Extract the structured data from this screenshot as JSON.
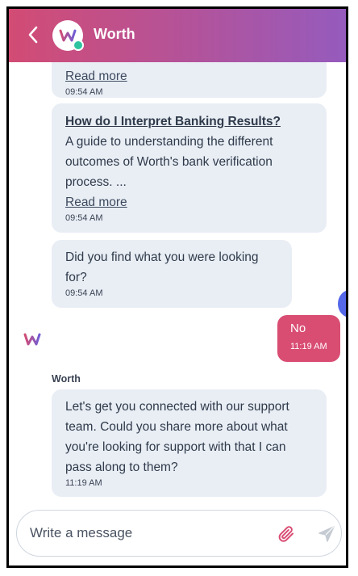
{
  "header": {
    "title": "Worth",
    "colors": {
      "gradient_start": "#d24c74",
      "gradient_end": "#955bbd"
    }
  },
  "messages": [
    {
      "id": "article-1-tail",
      "link_label": "Read more",
      "time": "09:54 AM"
    },
    {
      "id": "article-2",
      "title": "How do I Interpret Banking Results?",
      "body_lines": [
        "A guide to understanding the different",
        "outcomes of Worth's bank verification",
        "process. ..."
      ],
      "link_label": "Read more",
      "time": "09:54 AM"
    },
    {
      "id": "prompt",
      "body_lines": [
        "Did you find what you were looking",
        "for?"
      ],
      "time": "09:54 AM"
    },
    {
      "id": "user-reply",
      "text": "No",
      "time": "11:19 AM",
      "color": "#d94d73"
    },
    {
      "id": "agent-reply",
      "sender": "Worth",
      "body_lines": [
        "Let's get you connected with our support",
        "team. Could you share more about what",
        "you're looking for support with that I can",
        "pass along to them?"
      ],
      "time": "11:19 AM"
    }
  ],
  "composer": {
    "placeholder": "Write a message",
    "attach_icon": "paperclip-icon",
    "send_icon": "send-icon"
  }
}
